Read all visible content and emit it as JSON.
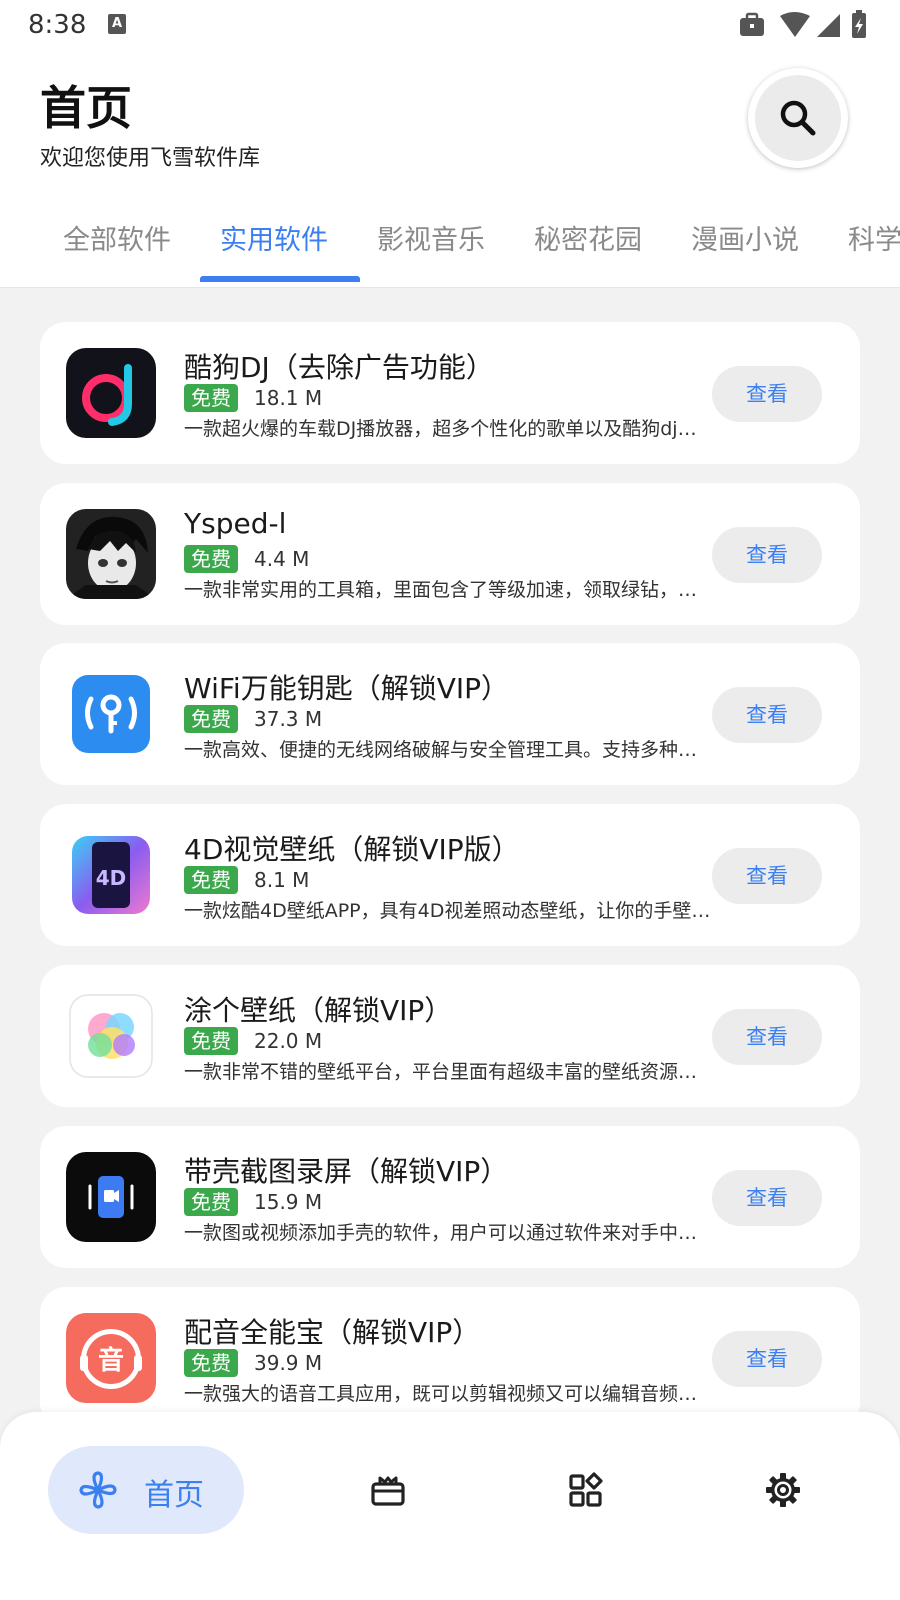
{
  "status": {
    "time": "8:38",
    "a_icon": "A"
  },
  "header": {
    "title": "首页",
    "subtitle": "欢迎您使用飞雪软件库"
  },
  "tabs": [
    {
      "label": "全部软件",
      "active": false
    },
    {
      "label": "实用软件",
      "active": true
    },
    {
      "label": "影视音乐",
      "active": false
    },
    {
      "label": "秘密花园",
      "active": false
    },
    {
      "label": "漫画小说",
      "active": false
    },
    {
      "label": "科学",
      "active": false
    }
  ],
  "colors": {
    "accent": "#3b7ff0",
    "free_badge": "#3aa84b",
    "background": "#f2f2f2"
  },
  "apps": [
    {
      "name": "酷狗DJ（去除广告功能）",
      "badge": "免费",
      "size": "18.1 M",
      "desc": "一款超火爆的车载DJ播放器，超多个性化的歌单以及酷狗dj…",
      "action": "查看",
      "icon": "kugou-dj-icon"
    },
    {
      "name": "Ysped-l",
      "badge": "免费",
      "size": "4.4 M",
      "desc": "一款非常实用的工具箱，里面包含了等级加速，领取绿钻，…",
      "action": "查看",
      "icon": "ysped-anime-avatar-icon"
    },
    {
      "name": "WiFi万能钥匙（解锁VIP）",
      "badge": "免费",
      "size": "37.3 M",
      "desc": "一款高效、便捷的无线网络破解与安全管理工具。支持多种…",
      "action": "查看",
      "icon": "wifi-key-icon"
    },
    {
      "name": "4D视觉壁纸（解锁VIP版）",
      "badge": "免费",
      "size": "8.1 M",
      "desc": "一款炫酷4D壁纸APP，具有4D视差照动态壁纸，让你的手壁…",
      "action": "查看",
      "icon": "4d-wallpaper-icon"
    },
    {
      "name": "涂个壁纸（解锁VIP）",
      "badge": "免费",
      "size": "22.0 M",
      "desc": "一款非常不错的壁纸平台，平台里面有超级丰富的壁纸资源…",
      "action": "查看",
      "icon": "paint-wallpaper-icon"
    },
    {
      "name": "带壳截图录屏（解锁VIP）",
      "badge": "免费",
      "size": "15.9 M",
      "desc": "一款图或视频添加手壳的软件，用户可以通过软件来对手中…",
      "action": "查看",
      "icon": "screenshot-recorder-icon"
    },
    {
      "name": "配音全能宝（解锁VIP）",
      "badge": "免费",
      "size": "39.9 M",
      "desc": "一款强大的语音工具应用，既可以剪辑视频又可以编辑音频…",
      "action": "查看",
      "icon": "dubbing-icon"
    }
  ],
  "bottom_nav": {
    "home_label": "首页",
    "items": [
      "pinwheel-icon",
      "gift-box-icon",
      "apps-grid-icon",
      "settings-gear-icon"
    ]
  }
}
